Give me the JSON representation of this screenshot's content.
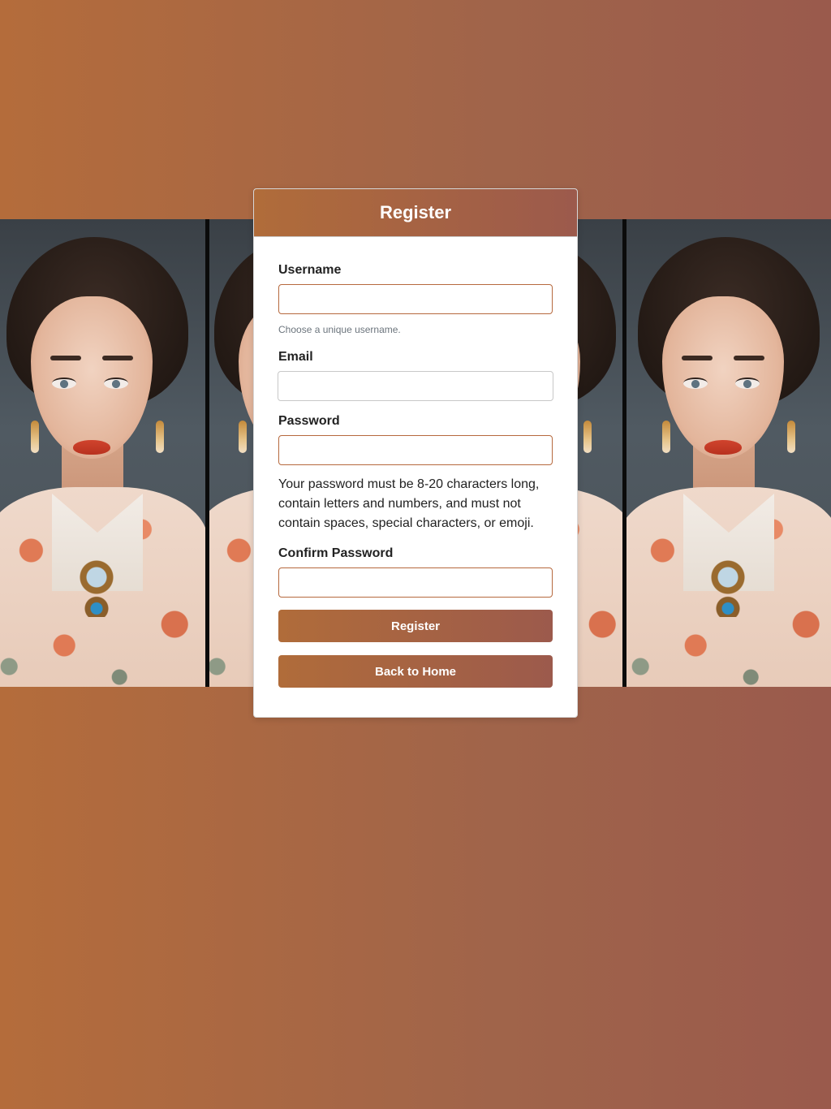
{
  "page": {
    "title": "Register"
  },
  "form": {
    "username": {
      "label": "Username",
      "value": "",
      "help": "Choose a unique username."
    },
    "email": {
      "label": "Email",
      "value": ""
    },
    "password": {
      "label": "Password",
      "value": "",
      "help": "Your password must be 8-20 characters long, contain letters and numbers, and must not contain spaces, special characters, or emoji."
    },
    "confirm_password": {
      "label": "Confirm Password",
      "value": ""
    },
    "register_button": "Register",
    "home_button": "Back to Home"
  },
  "colors": {
    "accent_start": "#b06c3a",
    "accent_end": "#9c5a4c",
    "input_border": "#b6693e"
  },
  "background": {
    "image": "portrait-of-woman-in-floral-jacket"
  }
}
